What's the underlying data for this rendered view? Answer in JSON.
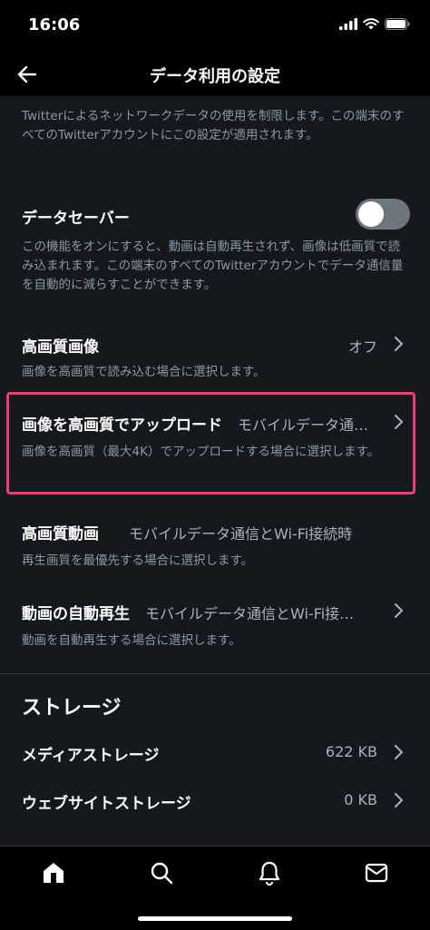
{
  "status_bar": {
    "time": "16:06"
  },
  "nav": {
    "title": "データ利用の設定"
  },
  "intro_text": "Twitterによるネットワークデータの使用を制限します。この端末のすべてのTwitterアカウントにこの設定が適用されます。",
  "data_saver": {
    "label": "データセーバー",
    "enabled": false,
    "description": "この機能をオンにすると、動画は自動再生されず、画像は低画質で読み込まれます。この端末のすべてのTwitterアカウントでデータ通信量を自動的に減らすことができます。"
  },
  "hq_images": {
    "label": "高画質画像",
    "value": "オフ",
    "description": "画像を高画質で読み込む場合に選択します。"
  },
  "hq_upload": {
    "label": "画像を高画質でアップロード",
    "value": "モバイルデータ通…",
    "description": "画像を高画質（最大4K）でアップロードする場合に選択します。"
  },
  "hq_video": {
    "label": "高画質動画",
    "value": "モバイルデータ通信とWi-Fi接続時",
    "description": "再生画質を最優先する場合に選択します。"
  },
  "autoplay": {
    "label": "動画の自動再生",
    "value": "モバイルデータ通信とWi-Fi接…",
    "description": "動画を自動再生する場合に選択します。"
  },
  "storage": {
    "title": "ストレージ",
    "media": {
      "label": "メディアストレージ",
      "value": "622 KB"
    },
    "web": {
      "label": "ウェブサイトストレージ",
      "value": "0 KB"
    }
  },
  "colors": {
    "highlight": "#ec3e74",
    "background": "#15181c",
    "toggle_off": "#6e767d"
  }
}
